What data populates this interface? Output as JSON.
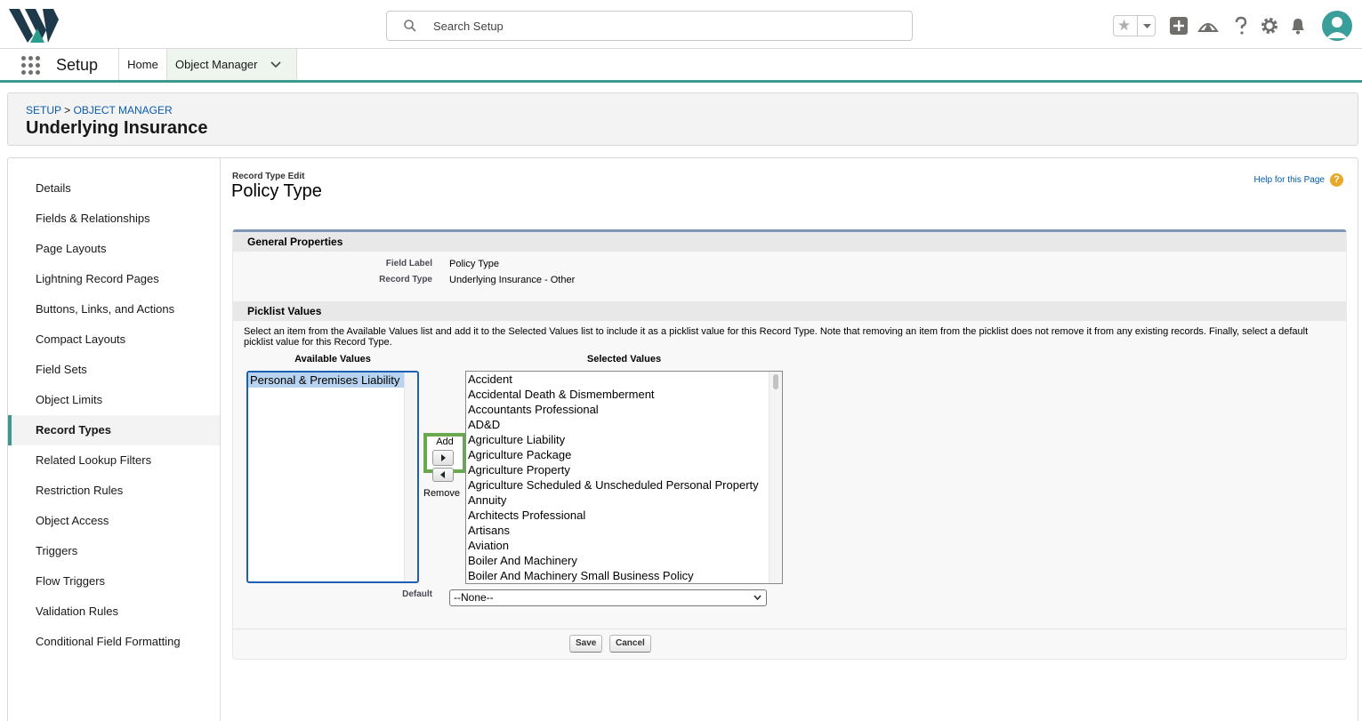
{
  "header": {
    "search_placeholder": "Search Setup",
    "icons": [
      "star-icon",
      "chevron-down-icon",
      "add-icon",
      "trailhead-icon",
      "help-icon",
      "gear-icon",
      "bell-icon",
      "avatar-icon"
    ]
  },
  "nav": {
    "app_name": "Setup",
    "tabs": [
      {
        "label": "Home"
      },
      {
        "label": "Object Manager"
      }
    ]
  },
  "page_header": {
    "breadcrumb_setup": "SETUP",
    "breadcrumb_sep": ">",
    "breadcrumb_object_manager": "OBJECT MANAGER",
    "title": "Underlying Insurance"
  },
  "sidebar": {
    "items": [
      {
        "label": "Details"
      },
      {
        "label": "Fields & Relationships"
      },
      {
        "label": "Page Layouts"
      },
      {
        "label": "Lightning Record Pages"
      },
      {
        "label": "Buttons, Links, and Actions"
      },
      {
        "label": "Compact Layouts"
      },
      {
        "label": "Field Sets"
      },
      {
        "label": "Object Limits"
      },
      {
        "label": "Record Types"
      },
      {
        "label": "Related Lookup Filters"
      },
      {
        "label": "Restriction Rules"
      },
      {
        "label": "Object Access"
      },
      {
        "label": "Triggers"
      },
      {
        "label": "Flow Triggers"
      },
      {
        "label": "Validation Rules"
      },
      {
        "label": "Conditional Field Formatting"
      }
    ],
    "active": "Record Types"
  },
  "edit": {
    "subtitle": "Record Type Edit",
    "title": "Policy Type",
    "help_link": "Help for this Page",
    "help_icon": "?",
    "general_properties": "General Properties",
    "field_label_label": "Field Label",
    "field_label_value": "Policy Type",
    "record_type_label": "Record Type",
    "record_type_value": "Underlying Insurance - Other",
    "picklist_values": "Picklist Values",
    "instructions": "Select an item from the Available Values list and add it to the Selected Values list to include it as a picklist value for this Record Type. Note that removing an item from the picklist does not remove it from any existing records. Finally, select a default picklist value for this Record Type.",
    "available_header": "Available Values",
    "selected_header": "Selected Values",
    "available_values": [
      "Personal & Premises Liability"
    ],
    "selected_values": [
      "Accident",
      "Accidental Death & Dismemberment",
      "Accountants Professional",
      "AD&D",
      "Agriculture Liability",
      "Agriculture Package",
      "Agriculture Property",
      "Agriculture Scheduled & Unscheduled Personal Property",
      "Annuity",
      "Architects Professional",
      "Artisans",
      "Aviation",
      "Boiler And Machinery",
      "Boiler And Machinery Small Business Policy"
    ],
    "add_label": "Add",
    "remove_label": "Remove",
    "default_label": "Default",
    "default_value": "--None--",
    "save_label": "Save",
    "cancel_label": "Cancel"
  },
  "colors": {
    "accent_teal": "#3b9a8e",
    "link_blue": "#0b5cab",
    "highlight_green": "#6aa84f"
  }
}
